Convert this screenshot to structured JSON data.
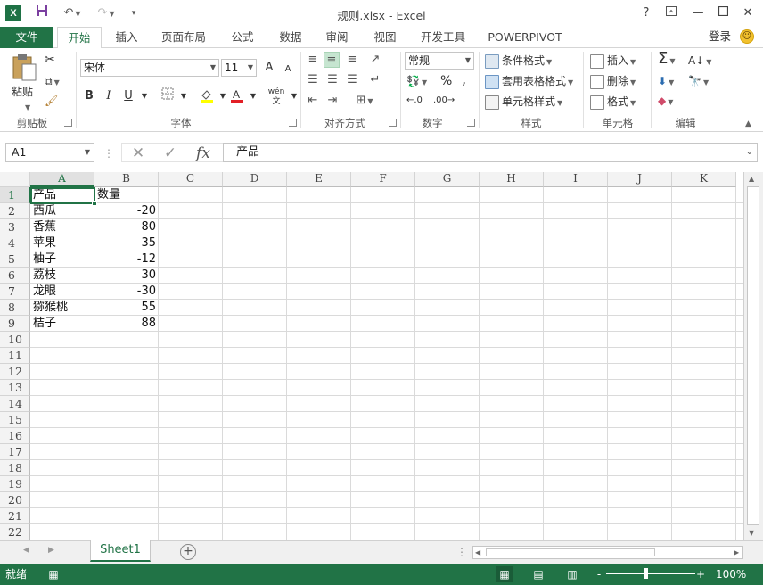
{
  "titlebar": {
    "title": "规则.xlsx - Excel",
    "app_icon": "X",
    "qat": [
      "save-icon",
      "undo-icon",
      "redo-icon",
      "customize-icon"
    ],
    "help": "?",
    "window_controls": [
      "ribbon-display-icon",
      "minimize-icon",
      "maximize-icon",
      "close-icon"
    ]
  },
  "tabs": {
    "file": "文件",
    "items": [
      "开始",
      "插入",
      "页面布局",
      "公式",
      "数据",
      "审阅",
      "视图",
      "开发工具",
      "POWERPIVOT"
    ],
    "active": "开始",
    "login": "登录"
  },
  "ribbon": {
    "clipboard": {
      "paste": "粘贴",
      "label": "剪贴板"
    },
    "font": {
      "name": "宋体",
      "size": "11",
      "label": "字体",
      "bold": "B",
      "italic": "I",
      "underline": "U",
      "grow": "A",
      "shrink": "A",
      "color_red": "#e21f26",
      "highlight_yellow": "#ffff00",
      "phonetic": "wén"
    },
    "alignment": {
      "label": "对齐方式"
    },
    "number": {
      "format": "常规",
      "label": "数字",
      "percent": "%",
      "comma": ","
    },
    "styles": {
      "conditional": "条件格式",
      "table": "套用表格格式",
      "cell": "单元格样式",
      "label": "样式"
    },
    "cells": {
      "insert": "插入",
      "delete": "删除",
      "format": "格式",
      "label": "单元格"
    },
    "editing": {
      "label": "编辑"
    }
  },
  "formula_bar": {
    "name_box": "A1",
    "fx": "fx",
    "content": "产品"
  },
  "grid": {
    "columns": [
      "A",
      "B",
      "C",
      "D",
      "E",
      "F",
      "G",
      "H",
      "I",
      "J",
      "K"
    ],
    "rows": [
      "1",
      "2",
      "3",
      "4",
      "5",
      "6",
      "7",
      "8",
      "9",
      "10",
      "11",
      "12",
      "13",
      "14",
      "15",
      "16",
      "17",
      "18",
      "19",
      "20",
      "21",
      "22"
    ],
    "data": [
      [
        "产品",
        "数量"
      ],
      [
        "西瓜",
        "-20"
      ],
      [
        "香蕉",
        "80"
      ],
      [
        "苹果",
        "35"
      ],
      [
        "柚子",
        "-12"
      ],
      [
        "荔枝",
        "30"
      ],
      [
        "龙眼",
        "-30"
      ],
      [
        "猕猴桃",
        "55"
      ],
      [
        "桔子",
        "88"
      ]
    ],
    "active_cell": "A1"
  },
  "sheets": {
    "tabs": [
      "Sheet1"
    ],
    "add": "+"
  },
  "status": {
    "text": "就绪",
    "zoom": "100%",
    "zoom_minus": "-",
    "zoom_plus": "+"
  },
  "colors": {
    "excel_green": "#217346",
    "active_cell_border": "#217346"
  }
}
